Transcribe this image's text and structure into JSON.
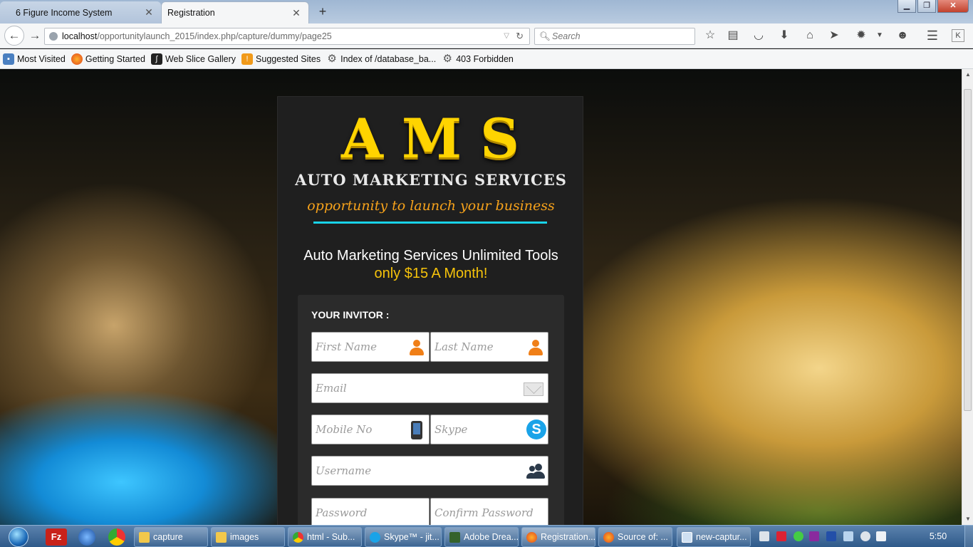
{
  "browser": {
    "tabs": [
      {
        "label": "6 Figure Income System",
        "active": false
      },
      {
        "label": "Registration",
        "active": true
      }
    ],
    "url": {
      "host": "localhost",
      "path": "/opportunitylaunch_2015/index.php/capture/dummy/page25"
    },
    "search_placeholder": "Search",
    "bookmarks": [
      {
        "label": "Most Visited",
        "icon": "bookmark-folder-icon"
      },
      {
        "label": "Getting Started",
        "icon": "firefox-icon"
      },
      {
        "label": "Web Slice Gallery",
        "icon": "web-slice-icon"
      },
      {
        "label": "Suggested Sites",
        "icon": "suggested-sites-icon"
      },
      {
        "label": "Index of /database_ba...",
        "icon": "gear-icon"
      },
      {
        "label": "403 Forbidden",
        "icon": "gear-icon"
      }
    ]
  },
  "page": {
    "logo": {
      "letters": "AMS",
      "subtitle": "AUTO MARKETING SERVICES",
      "tagline": "opportunity to launch your business"
    },
    "headline": "Auto Marketing Services Unlimited Tools",
    "price": "only $15 A Month!",
    "form": {
      "invitor_label": "YOUR INVITOR :",
      "fields": {
        "first_name": "First Name",
        "last_name": "Last Name",
        "email": "Email",
        "mobile": "Mobile No",
        "skype": "Skype",
        "username": "Username",
        "password": "Password",
        "confirm_password": "Confirm Password"
      }
    },
    "colors": {
      "accent_yellow": "#ffd400",
      "tagline_orange": "#f6a21b",
      "rule_cyan": "#19d3e8",
      "panel": "#1f1f1f"
    }
  },
  "taskbar": {
    "buttons": [
      {
        "label": "capture",
        "icon": "folder-icon"
      },
      {
        "label": "images",
        "icon": "folder-icon"
      },
      {
        "label": "html - Sub...",
        "icon": "chrome-icon"
      },
      {
        "label": "Skype™ - jit...",
        "icon": "skype-icon"
      },
      {
        "label": "Adobe Drea...",
        "icon": "dreamweaver-icon"
      },
      {
        "label": "Registration...",
        "icon": "firefox-icon"
      },
      {
        "label": "Source of: ...",
        "icon": "firefox-icon"
      },
      {
        "label": "new-captur...",
        "icon": "window-icon"
      }
    ],
    "clock": "5:50 PM"
  }
}
